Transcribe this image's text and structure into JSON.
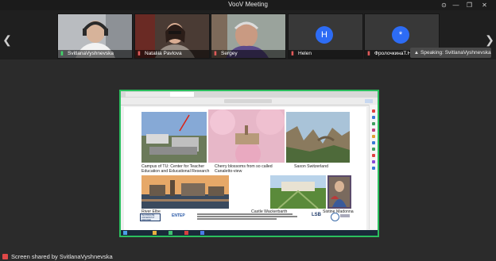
{
  "window": {
    "title": "VooV Meeting"
  },
  "participants": [
    {
      "name": "SvitlanaVyshnevska",
      "mic": "on"
    },
    {
      "name": "Nataliia Pavlova",
      "mic": "muted"
    },
    {
      "name": "Sergey",
      "mic": "muted"
    },
    {
      "name": "Helen",
      "mic": "muted",
      "initial": "H"
    },
    {
      "name": "ФролочкинаТ.Н.",
      "mic": "muted",
      "initial": "*"
    }
  ],
  "speaking": {
    "label": "Speaking: SvitlanaVyshnevska"
  },
  "slide": {
    "captions": {
      "campus": "Campus of TU: Center for Teacher",
      "campus2": "Education and Educational Research",
      "cherry": "Cherry blossoms from so called",
      "cherry2": "Canaletto-view",
      "saxon": "Saxon Switzerland",
      "elbe": "River Elbe",
      "castle": "Castle Wackerbarth",
      "madonna": "Sistine Madonna"
    },
    "logos": {
      "tu": "TECHNISCHE UNIVERSITÄT DRESDEN",
      "entep": "ENTEP",
      "lsb": "LSB"
    }
  },
  "share_status": {
    "label": "Screen shared by SvitlanaVyshnevska"
  },
  "colors": {
    "share_border": "#2bbf5e",
    "avatar_blue": "#2d6cf5"
  }
}
